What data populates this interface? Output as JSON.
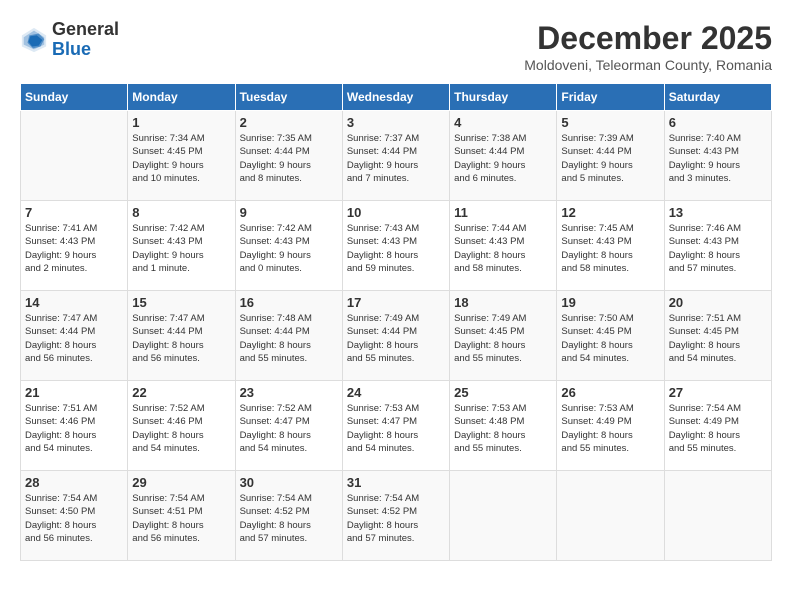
{
  "logo": {
    "general": "General",
    "blue": "Blue"
  },
  "title": "December 2025",
  "location": "Moldoveni, Teleorman County, Romania",
  "days_header": [
    "Sunday",
    "Monday",
    "Tuesday",
    "Wednesday",
    "Thursday",
    "Friday",
    "Saturday"
  ],
  "weeks": [
    [
      {
        "day": "",
        "info": ""
      },
      {
        "day": "1",
        "info": "Sunrise: 7:34 AM\nSunset: 4:45 PM\nDaylight: 9 hours\nand 10 minutes."
      },
      {
        "day": "2",
        "info": "Sunrise: 7:35 AM\nSunset: 4:44 PM\nDaylight: 9 hours\nand 8 minutes."
      },
      {
        "day": "3",
        "info": "Sunrise: 7:37 AM\nSunset: 4:44 PM\nDaylight: 9 hours\nand 7 minutes."
      },
      {
        "day": "4",
        "info": "Sunrise: 7:38 AM\nSunset: 4:44 PM\nDaylight: 9 hours\nand 6 minutes."
      },
      {
        "day": "5",
        "info": "Sunrise: 7:39 AM\nSunset: 4:44 PM\nDaylight: 9 hours\nand 5 minutes."
      },
      {
        "day": "6",
        "info": "Sunrise: 7:40 AM\nSunset: 4:43 PM\nDaylight: 9 hours\nand 3 minutes."
      }
    ],
    [
      {
        "day": "7",
        "info": "Sunrise: 7:41 AM\nSunset: 4:43 PM\nDaylight: 9 hours\nand 2 minutes."
      },
      {
        "day": "8",
        "info": "Sunrise: 7:42 AM\nSunset: 4:43 PM\nDaylight: 9 hours\nand 1 minute."
      },
      {
        "day": "9",
        "info": "Sunrise: 7:42 AM\nSunset: 4:43 PM\nDaylight: 9 hours\nand 0 minutes."
      },
      {
        "day": "10",
        "info": "Sunrise: 7:43 AM\nSunset: 4:43 PM\nDaylight: 8 hours\nand 59 minutes."
      },
      {
        "day": "11",
        "info": "Sunrise: 7:44 AM\nSunset: 4:43 PM\nDaylight: 8 hours\nand 58 minutes."
      },
      {
        "day": "12",
        "info": "Sunrise: 7:45 AM\nSunset: 4:43 PM\nDaylight: 8 hours\nand 58 minutes."
      },
      {
        "day": "13",
        "info": "Sunrise: 7:46 AM\nSunset: 4:43 PM\nDaylight: 8 hours\nand 57 minutes."
      }
    ],
    [
      {
        "day": "14",
        "info": "Sunrise: 7:47 AM\nSunset: 4:44 PM\nDaylight: 8 hours\nand 56 minutes."
      },
      {
        "day": "15",
        "info": "Sunrise: 7:47 AM\nSunset: 4:44 PM\nDaylight: 8 hours\nand 56 minutes."
      },
      {
        "day": "16",
        "info": "Sunrise: 7:48 AM\nSunset: 4:44 PM\nDaylight: 8 hours\nand 55 minutes."
      },
      {
        "day": "17",
        "info": "Sunrise: 7:49 AM\nSunset: 4:44 PM\nDaylight: 8 hours\nand 55 minutes."
      },
      {
        "day": "18",
        "info": "Sunrise: 7:49 AM\nSunset: 4:45 PM\nDaylight: 8 hours\nand 55 minutes."
      },
      {
        "day": "19",
        "info": "Sunrise: 7:50 AM\nSunset: 4:45 PM\nDaylight: 8 hours\nand 54 minutes."
      },
      {
        "day": "20",
        "info": "Sunrise: 7:51 AM\nSunset: 4:45 PM\nDaylight: 8 hours\nand 54 minutes."
      }
    ],
    [
      {
        "day": "21",
        "info": "Sunrise: 7:51 AM\nSunset: 4:46 PM\nDaylight: 8 hours\nand 54 minutes."
      },
      {
        "day": "22",
        "info": "Sunrise: 7:52 AM\nSunset: 4:46 PM\nDaylight: 8 hours\nand 54 minutes."
      },
      {
        "day": "23",
        "info": "Sunrise: 7:52 AM\nSunset: 4:47 PM\nDaylight: 8 hours\nand 54 minutes."
      },
      {
        "day": "24",
        "info": "Sunrise: 7:53 AM\nSunset: 4:47 PM\nDaylight: 8 hours\nand 54 minutes."
      },
      {
        "day": "25",
        "info": "Sunrise: 7:53 AM\nSunset: 4:48 PM\nDaylight: 8 hours\nand 55 minutes."
      },
      {
        "day": "26",
        "info": "Sunrise: 7:53 AM\nSunset: 4:49 PM\nDaylight: 8 hours\nand 55 minutes."
      },
      {
        "day": "27",
        "info": "Sunrise: 7:54 AM\nSunset: 4:49 PM\nDaylight: 8 hours\nand 55 minutes."
      }
    ],
    [
      {
        "day": "28",
        "info": "Sunrise: 7:54 AM\nSunset: 4:50 PM\nDaylight: 8 hours\nand 56 minutes."
      },
      {
        "day": "29",
        "info": "Sunrise: 7:54 AM\nSunset: 4:51 PM\nDaylight: 8 hours\nand 56 minutes."
      },
      {
        "day": "30",
        "info": "Sunrise: 7:54 AM\nSunset: 4:52 PM\nDaylight: 8 hours\nand 57 minutes."
      },
      {
        "day": "31",
        "info": "Sunrise: 7:54 AM\nSunset: 4:52 PM\nDaylight: 8 hours\nand 57 minutes."
      },
      {
        "day": "",
        "info": ""
      },
      {
        "day": "",
        "info": ""
      },
      {
        "day": "",
        "info": ""
      }
    ]
  ]
}
